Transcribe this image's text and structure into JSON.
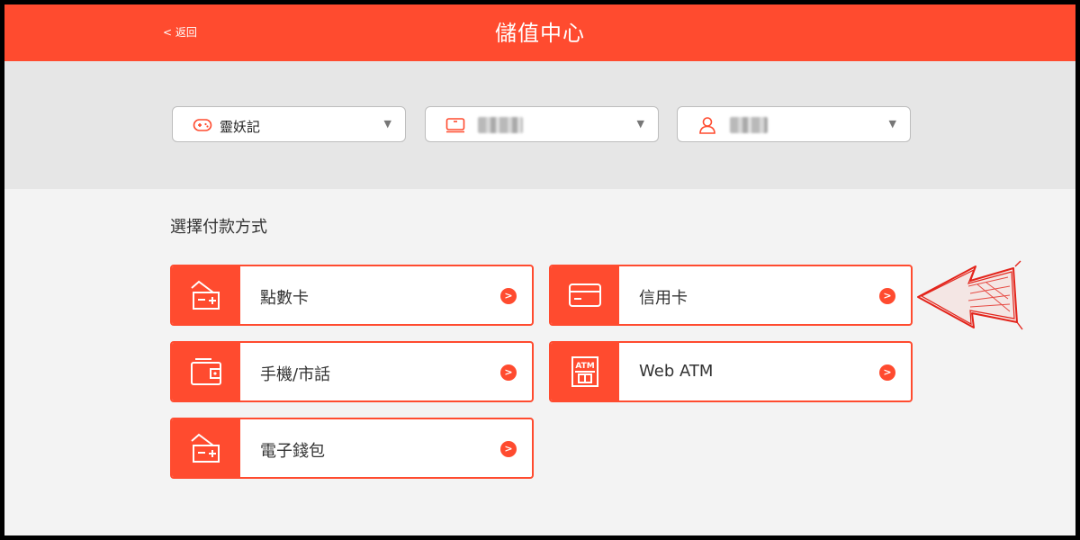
{
  "header": {
    "back_label": "< 返回",
    "title": "儲值中心"
  },
  "selectors": [
    {
      "icon": "gamepad-icon",
      "value": "靈妖記",
      "blurred": false
    },
    {
      "icon": "server-icon",
      "value": "",
      "blurred": true
    },
    {
      "icon": "user-icon",
      "value": "",
      "blurred": true
    }
  ],
  "section_label": "選擇付款方式",
  "payment_methods": [
    {
      "label": "點數卡",
      "icon": "card-receipt-icon"
    },
    {
      "label": "信用卡",
      "icon": "credit-card-icon"
    },
    {
      "label": "手機/市話",
      "icon": "wallet-phone-icon"
    },
    {
      "label": "Web ATM",
      "icon": "atm-icon"
    },
    {
      "label": "電子錢包",
      "icon": "card-receipt-icon"
    }
  ],
  "colors": {
    "accent": "#ff4b2f",
    "band": "#e6e6e6",
    "background": "#f3f3f3"
  }
}
